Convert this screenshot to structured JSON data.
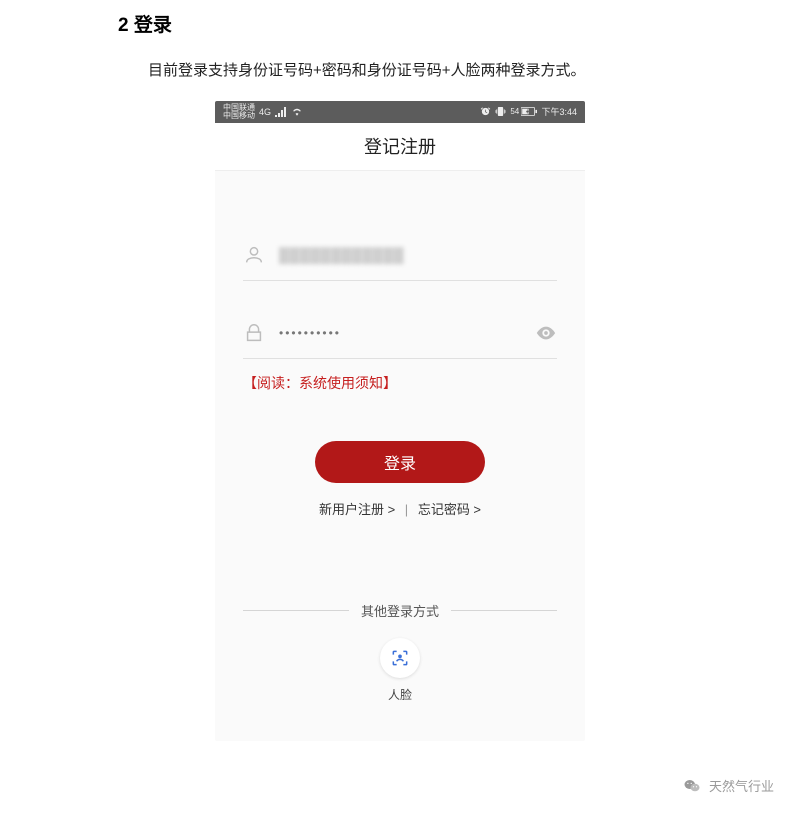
{
  "doc": {
    "heading": "2 登录",
    "body": "目前登录支持身份证号码+密码和身份证号码+人脸两种登录方式。"
  },
  "statusbar": {
    "carrier1": "中国联通",
    "carrier2": "中国移动",
    "net": "4G",
    "battery": "54",
    "time": "下午3:44"
  },
  "appbar": {
    "title": "登记注册"
  },
  "fields": {
    "id_masked": "████████████",
    "password_dots": "••••••••••"
  },
  "notice": "【阅读：系统使用须知】",
  "buttons": {
    "login": "登录"
  },
  "links": {
    "register": "新用户注册 >",
    "forgot": "忘记密码 >",
    "sep": "|"
  },
  "other": {
    "label": "其他登录方式",
    "face": "人脸"
  },
  "watermark": {
    "text": "天然气行业"
  }
}
